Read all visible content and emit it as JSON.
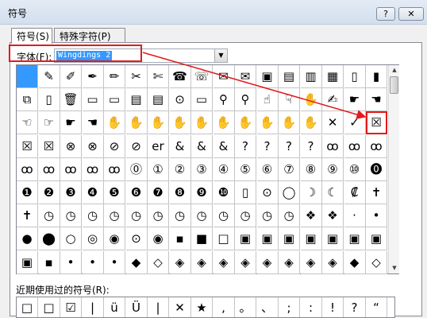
{
  "window": {
    "title": "符号",
    "help_label": "?",
    "close_label": "✕"
  },
  "tabs": [
    {
      "label": "符号(S)",
      "active": true
    },
    {
      "label": "特殊字符(P)",
      "active": false
    }
  ],
  "font": {
    "label": "字体(F):",
    "value": "Wingdings 2"
  },
  "symbol_grid": {
    "selected_index": 0,
    "highlighted_index": 50,
    "rows": [
      [
        "",
        "✎",
        "✐",
        "✒",
        "✏",
        "✂",
        "✄",
        "☎",
        "☏",
        "✉",
        "✉",
        "▣",
        "▤",
        "▥",
        "▦",
        "▯",
        "▮"
      ],
      [
        "⧉",
        "▯",
        "🗑",
        "▭",
        "▭",
        "▤",
        "▤",
        "⊙",
        "▭",
        "⚲",
        "⚲",
        "☝",
        "☟",
        "✋",
        "✍",
        "☛",
        "☚"
      ],
      [
        "☜",
        "☞",
        "☛",
        "☚",
        "✋",
        "✋",
        "✋",
        "✋",
        "✋",
        "✋",
        "✋",
        "✋",
        "✋",
        "✋",
        "✕",
        "✓",
        "☒",
        "☑"
      ],
      [
        "☒",
        "☒",
        "⊗",
        "⊗",
        "⊘",
        "⊘",
        "er",
        "&",
        "&",
        "&",
        "?",
        "?",
        "?",
        "?",
        "ꝏ",
        "ꝏ",
        "ꝏ"
      ],
      [
        "ꝏ",
        "ꝏ",
        "ꝏ",
        "ꝏ",
        "ꝏ",
        "⓪",
        "①",
        "②",
        "③",
        "④",
        "⑤",
        "⑥",
        "⑦",
        "⑧",
        "⑨",
        "⑩",
        "⓿"
      ],
      [
        "❶",
        "❷",
        "❸",
        "❹",
        "❺",
        "❻",
        "❼",
        "❽",
        "❾",
        "❿",
        "▯",
        "⊙",
        "◯",
        "☽",
        "☾",
        "₡",
        "✝"
      ],
      [
        "✝",
        "◷",
        "◷",
        "◷",
        "◷",
        "◷",
        "◷",
        "◷",
        "◷",
        "◷",
        "◷",
        "◷",
        "◷",
        "❖",
        "❖",
        "·",
        "•"
      ],
      [
        "●",
        "⬤",
        "○",
        "◎",
        "◉",
        "⊙",
        "◉",
        "▪",
        "■",
        "□",
        "▣",
        "▣",
        "▣",
        "▣",
        "▣",
        "▣",
        "▣"
      ],
      [
        "▣",
        "▪",
        "•",
        "•",
        "•",
        "◆",
        "◇",
        "◈",
        "◈",
        "◈",
        "◈",
        "◈",
        "◈",
        "◈",
        "◈",
        "◆",
        "◇"
      ]
    ]
  },
  "recent": {
    "label": "近期使用过的符号(R):",
    "symbols": [
      "□",
      "□",
      "☑",
      "|",
      "ü",
      "Ü",
      "|",
      "✕",
      "★",
      ",",
      "。",
      "、",
      ";",
      ":",
      "!",
      "?",
      "“"
    ]
  },
  "colors": {
    "annotation_red": "#e31a1c",
    "selection_blue": "#3399ff"
  }
}
